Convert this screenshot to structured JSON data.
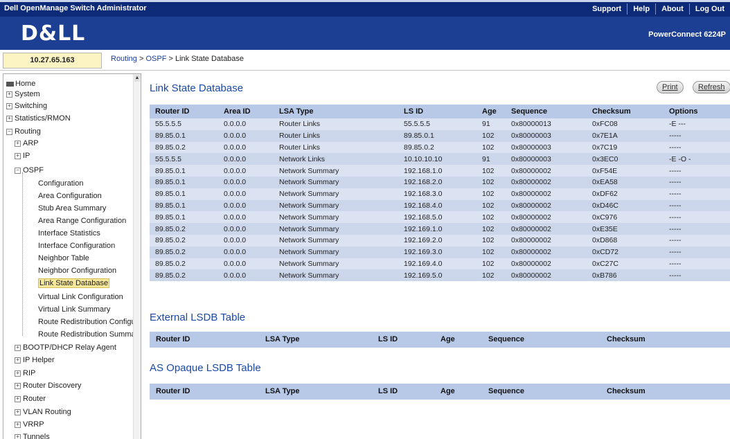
{
  "app": {
    "title": "Dell OpenManage Switch Administrator",
    "logo": "D&LL",
    "product": "PowerConnect 6224P"
  },
  "top_links": [
    "Support",
    "Help",
    "About",
    "Log Out"
  ],
  "ip": "10.27.65.163",
  "breadcrumb": {
    "part1": "Routing",
    "sep": " > ",
    "part2": "OSPF",
    "current": "Link State Database"
  },
  "sidebar": {
    "items": [
      {
        "label": "Home"
      },
      {
        "label": "System"
      },
      {
        "label": "Switching"
      },
      {
        "label": "Statistics/RMON"
      },
      {
        "label": "Routing"
      },
      {
        "label": "ARP"
      },
      {
        "label": "IP"
      },
      {
        "label": "OSPF"
      },
      {
        "label": "Configuration"
      },
      {
        "label": "Area Configuration"
      },
      {
        "label": "Stub Area Summary"
      },
      {
        "label": "Area Range Configuration"
      },
      {
        "label": "Interface Statistics"
      },
      {
        "label": "Interface Configuration"
      },
      {
        "label": "Neighbor Table"
      },
      {
        "label": "Neighbor Configuration"
      },
      {
        "label": "Link State Database"
      },
      {
        "label": "Virtual Link Configuration"
      },
      {
        "label": "Virtual Link Summary"
      },
      {
        "label": "Route Redistribution Configu"
      },
      {
        "label": "Route Redistribution Summa"
      },
      {
        "label": "BOOTP/DHCP Relay Agent"
      },
      {
        "label": "IP Helper"
      },
      {
        "label": "RIP"
      },
      {
        "label": "Router Discovery"
      },
      {
        "label": "Router"
      },
      {
        "label": "VLAN Routing"
      },
      {
        "label": "VRRP"
      },
      {
        "label": "Tunnels"
      }
    ]
  },
  "main": {
    "title": "Link State Database",
    "print_label": "Print",
    "refresh_label": "Refresh",
    "columns": [
      "Router ID",
      "Area ID",
      "LSA Type",
      "LS ID",
      "Age",
      "Sequence",
      "Checksum",
      "Options"
    ],
    "rows": [
      [
        "55.5.5.5",
        "0.0.0.0",
        "Router Links",
        "55.5.5.5",
        "91",
        "0x80000013",
        "0xFC08",
        "-E ---"
      ],
      [
        "89.85.0.1",
        "0.0.0.0",
        "Router Links",
        "89.85.0.1",
        "102",
        "0x80000003",
        "0x7E1A",
        "-----"
      ],
      [
        "89.85.0.2",
        "0.0.0.0",
        "Router Links",
        "89.85.0.2",
        "102",
        "0x80000003",
        "0x7C19",
        "-----"
      ],
      [
        "55.5.5.5",
        "0.0.0.0",
        "Network Links",
        "10.10.10.10",
        "91",
        "0x80000003",
        "0x3EC0",
        "-E -O -"
      ],
      [
        "89.85.0.1",
        "0.0.0.0",
        "Network Summary",
        "192.168.1.0",
        "102",
        "0x80000002",
        "0xF54E",
        "-----"
      ],
      [
        "89.85.0.1",
        "0.0.0.0",
        "Network Summary",
        "192.168.2.0",
        "102",
        "0x80000002",
        "0xEA58",
        "-----"
      ],
      [
        "89.85.0.1",
        "0.0.0.0",
        "Network Summary",
        "192.168.3.0",
        "102",
        "0x80000002",
        "0xDF62",
        "-----"
      ],
      [
        "89.85.0.1",
        "0.0.0.0",
        "Network Summary",
        "192.168.4.0",
        "102",
        "0x80000002",
        "0xD46C",
        "-----"
      ],
      [
        "89.85.0.1",
        "0.0.0.0",
        "Network Summary",
        "192.168.5.0",
        "102",
        "0x80000002",
        "0xC976",
        "-----"
      ],
      [
        "89.85.0.2",
        "0.0.0.0",
        "Network Summary",
        "192.169.1.0",
        "102",
        "0x80000002",
        "0xE35E",
        "-----"
      ],
      [
        "89.85.0.2",
        "0.0.0.0",
        "Network Summary",
        "192.169.2.0",
        "102",
        "0x80000002",
        "0xD868",
        "-----"
      ],
      [
        "89.85.0.2",
        "0.0.0.0",
        "Network Summary",
        "192.169.3.0",
        "102",
        "0x80000002",
        "0xCD72",
        "-----"
      ],
      [
        "89.85.0.2",
        "0.0.0.0",
        "Network Summary",
        "192.169.4.0",
        "102",
        "0x80000002",
        "0xC27C",
        "-----"
      ],
      [
        "89.85.0.2",
        "0.0.0.0",
        "Network Summary",
        "192.169.5.0",
        "102",
        "0x80000002",
        "0xB786",
        "-----"
      ]
    ],
    "external": {
      "title": "External LSDB Table",
      "columns": [
        "Router ID",
        "LSA Type",
        "LS ID",
        "Age",
        "Sequence",
        "Checksum"
      ]
    },
    "opaque": {
      "title": "AS Opaque LSDB Table",
      "columns": [
        "Router ID",
        "LSA Type",
        "LS ID",
        "Age",
        "Sequence",
        "Checksum"
      ]
    }
  }
}
